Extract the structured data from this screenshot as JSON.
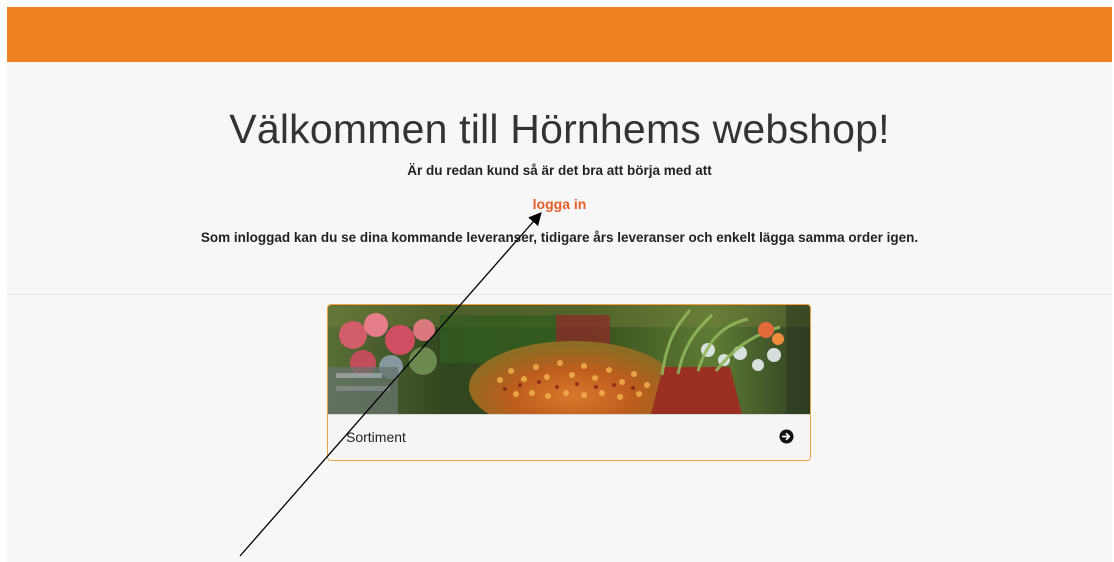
{
  "header": {
    "bar_color": "#ee8220"
  },
  "hero": {
    "title": "Välkommen till Hörnhems webshop!",
    "lead": "Är du redan kund så är det bra att börja med att",
    "login_label": "logga in",
    "info": "Som inloggad kan du se dina kommande leveranser, tidigare års leveranser och enkelt lägga samma order igen."
  },
  "card": {
    "label": "Sortiment",
    "icon": "arrow-circle-right-icon",
    "image": "flower-arrangement-photo"
  },
  "colors": {
    "accent": "#ee8220",
    "link": "#e65c26",
    "card_border": "#f0a040",
    "background": "#f7f7f7"
  }
}
